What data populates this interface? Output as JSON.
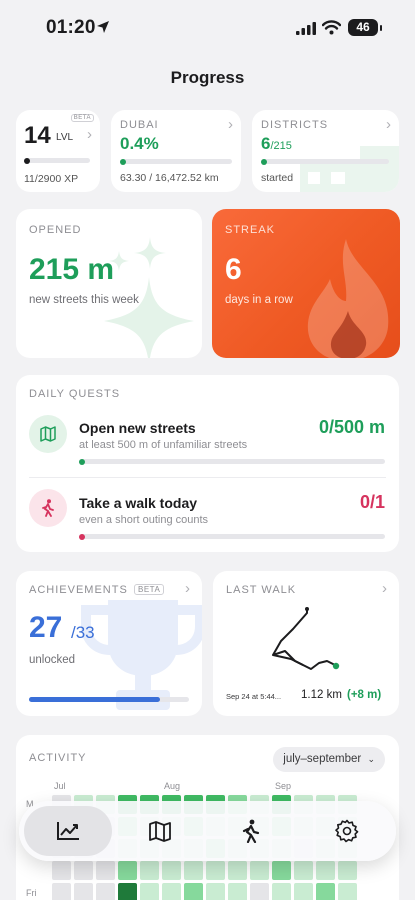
{
  "status": {
    "time": "01:20",
    "battery": "46"
  },
  "page": {
    "title": "Progress"
  },
  "level": {
    "value": "14",
    "unit": "LVL",
    "badge": "BETA",
    "xp": "11/2900 XP",
    "progress": 0.004
  },
  "city": {
    "name": "DUBAI",
    "percent": "0.4%",
    "covered": "63.30 / 16,472.52 km",
    "progress": 0.004
  },
  "districts": {
    "title": "DISTRICTS",
    "value": "6",
    "total": "/215",
    "caption": "started",
    "progress": 0.03
  },
  "opened": {
    "title": "OPENED",
    "value": "215 m",
    "caption": "new streets this week"
  },
  "streak": {
    "title": "STREAK",
    "value": "6",
    "caption": "days in a row"
  },
  "quests": {
    "title": "DAILY QUESTS",
    "items": [
      {
        "title": "Open new streets",
        "desc": "at least 500 m of unfamiliar streets",
        "value": "0/500 m",
        "progress": 0,
        "color": "#1e9e5a"
      },
      {
        "title": "Take a walk today",
        "desc": "even a short outing counts",
        "value": "0/1",
        "progress": 0,
        "color": "#d6335e"
      }
    ]
  },
  "achievements": {
    "title": "ACHIEVEMENTS",
    "badge": "BETA",
    "value": "27",
    "total": "/33",
    "caption": "unlocked",
    "progress": 0.8182
  },
  "last_walk": {
    "title": "LAST WALK",
    "date": "Sep 24 at 5:44...",
    "distance": "1.12 km",
    "delta": "(+8 m)"
  },
  "activity": {
    "title": "ACTIVITY",
    "range": "july–september",
    "months": [
      "Jul",
      "Aug",
      "Sep"
    ],
    "day_labels": [
      "M",
      "Fri"
    ],
    "levels": [
      [
        0,
        1,
        1,
        3,
        3,
        3,
        3,
        3,
        2,
        1,
        3,
        1,
        1,
        1
      ],
      [
        0,
        0,
        0,
        2,
        1,
        1,
        2,
        1,
        1,
        1,
        2,
        1,
        1,
        1
      ],
      [
        0,
        0,
        0,
        1,
        1,
        1,
        1,
        2,
        1,
        1,
        1,
        0,
        1,
        1
      ],
      [
        0,
        0,
        0,
        2,
        1,
        1,
        1,
        1,
        1,
        1,
        2,
        1,
        1,
        1
      ],
      [
        0,
        0,
        0,
        4,
        1,
        1,
        2,
        1,
        1,
        0,
        1,
        1,
        2,
        1
      ],
      [
        0,
        0,
        0,
        4,
        3,
        3,
        4,
        3,
        2,
        1,
        3,
        1,
        1,
        3
      ]
    ],
    "level_colors": [
      "#e5e5e8",
      "#c9ecd2",
      "#86d99c",
      "#3fba63",
      "#1f7a3a"
    ]
  },
  "tabs": [
    {
      "name": "progress",
      "icon": "chart-icon",
      "active": true
    },
    {
      "name": "map",
      "icon": "map-icon",
      "active": false
    },
    {
      "name": "walk",
      "icon": "walk-icon",
      "active": false
    },
    {
      "name": "settings",
      "icon": "gear-icon",
      "active": false
    }
  ]
}
